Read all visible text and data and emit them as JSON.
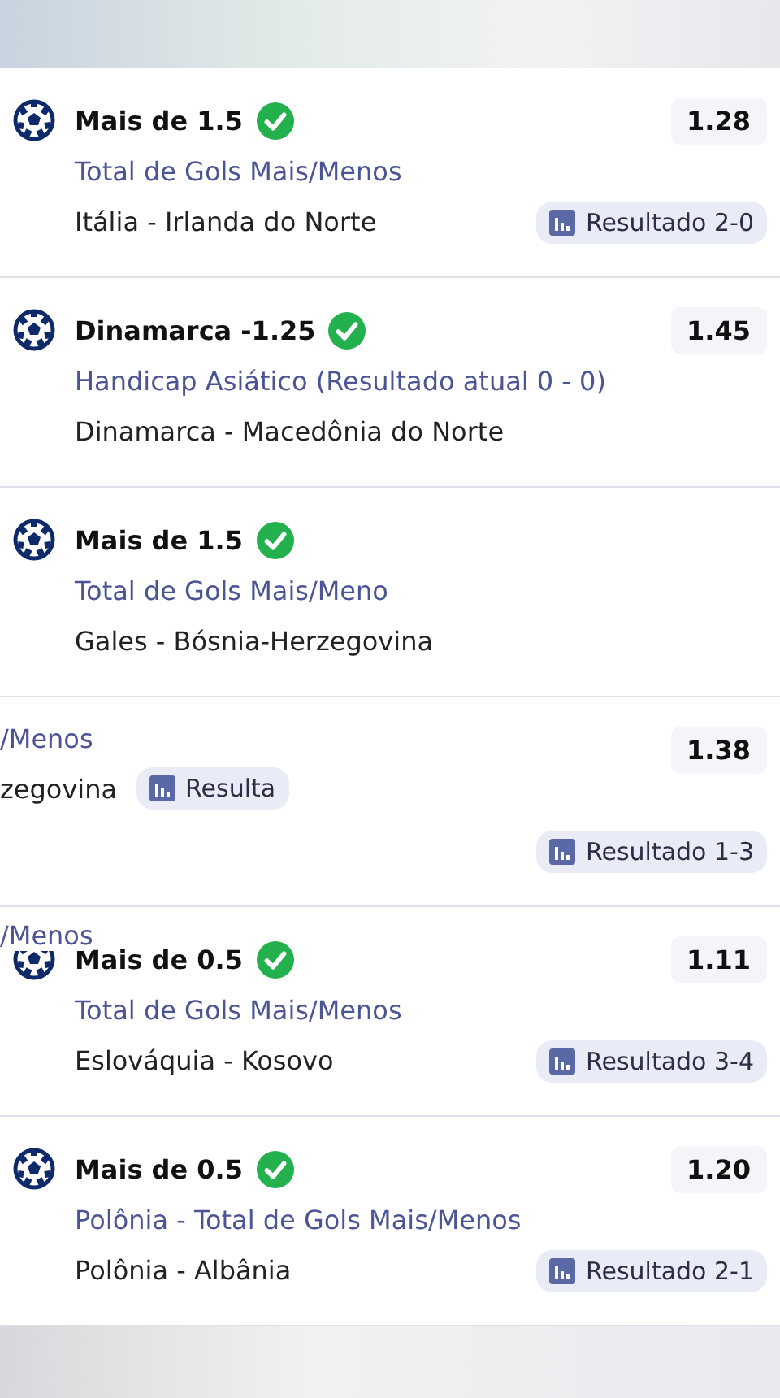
{
  "bets": [
    {
      "title": "Mais de 1.5",
      "won": true,
      "market": "Total de Gols Mais/Menos",
      "match": "Itália - Irlanda do Norte",
      "odds": "1.28",
      "result": "Resultado 2-0"
    },
    {
      "title": "Dinamarca -1.25",
      "won": true,
      "market": "Handicap Asiático (Resultado atual 0 - 0)",
      "match": "Dinamarca - Macedônia do Norte",
      "odds": "1.45"
    },
    {
      "title": "Mais de 1.5",
      "won": true,
      "market": "Total de Gols Mais/Meno",
      "match": "Gales - Bósnia-Herzegovina"
    },
    {
      "odds": "1.38",
      "result": "Resultado 1-3"
    },
    {
      "title": "Mais de 0.5",
      "won": true,
      "market": "Total de Gols Mais/Menos",
      "match": "Eslováquia - Kosovo",
      "odds": "1.11",
      "result": "Resultado 3-4"
    },
    {
      "title": "Mais de 0.5",
      "won": true,
      "market": "Polônia - Total de Gols Mais/Menos",
      "match": "Polônia - Albânia",
      "odds": "1.20",
      "result": "Resultado 2-1"
    }
  ],
  "glitch_fragments": [
    {
      "market": "/Menos",
      "match": "zegovina",
      "result": "Resulta"
    },
    {
      "market": "/Menos"
    }
  ]
}
